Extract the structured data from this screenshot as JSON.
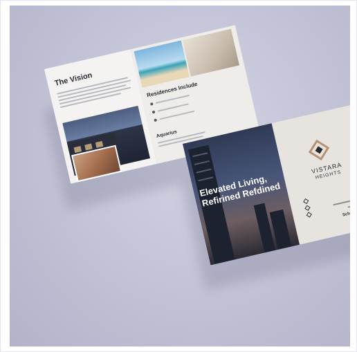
{
  "scene": {
    "background_color": "#c6c6d9",
    "accent_color": "#b8926e"
  },
  "brochure_left": {
    "title": "The Vision",
    "residences_title": "Residences Include",
    "section_title": "Aquarius"
  },
  "brochure_right": {
    "headline_line1": "Elevated Living,",
    "headline_line2": "Refirined Refdined",
    "brand_name": "VISTARA",
    "brand_sub": "HEIGHTS",
    "cta": "Schedule a Visit"
  }
}
